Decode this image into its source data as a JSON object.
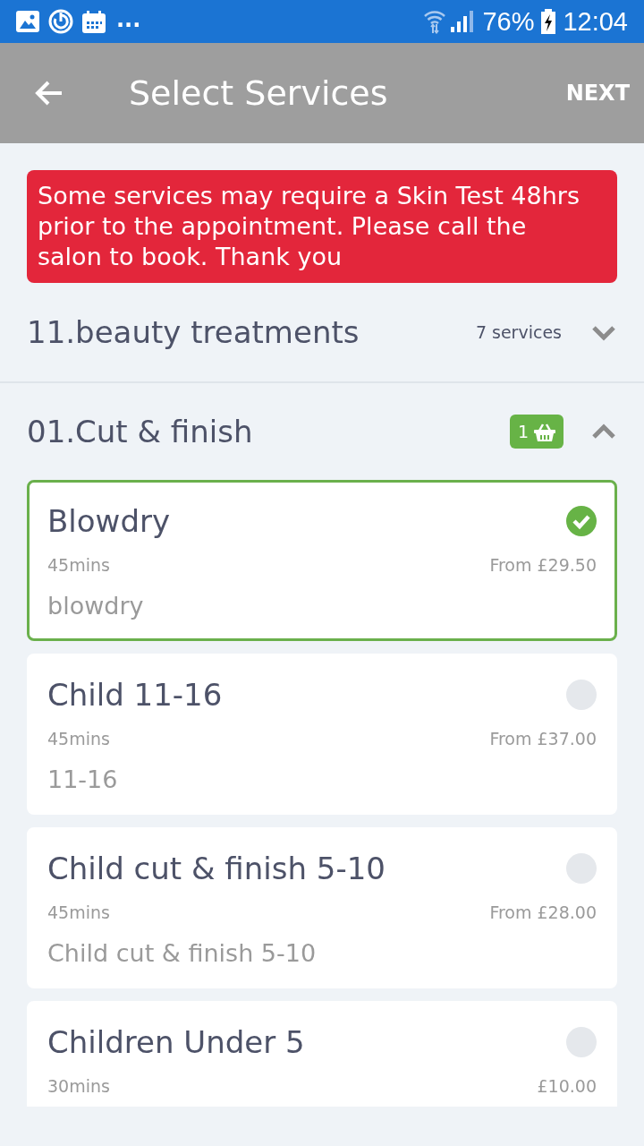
{
  "status_bar": {
    "overflow": "...",
    "battery_level": "76%",
    "time": "12:04"
  },
  "app_bar": {
    "title": "Select Services",
    "action": "NEXT"
  },
  "notice": "Some services may require a Skin Test 48hrs prior to the appointment. Please call the salon to book. Thank you",
  "categories": [
    {
      "name": "11.beauty treatments",
      "count": "7 services",
      "expanded": false
    },
    {
      "name": "01.Cut & finish",
      "basket_count": "1",
      "expanded": true,
      "services": [
        {
          "name": "Blowdry",
          "duration": "45mins",
          "price": "From £29.50",
          "description": "blowdry",
          "selected": true
        },
        {
          "name": "Child 11-16",
          "duration": "45mins",
          "price": "From £37.00",
          "description": "11-16",
          "selected": false
        },
        {
          "name": "Child cut & finish 5-10",
          "duration": "45mins",
          "price": "From £28.00",
          "description": "Child cut & finish 5-10",
          "selected": false
        },
        {
          "name": "Children Under 5",
          "duration": "30mins",
          "price": "£10.00",
          "selected": false
        }
      ]
    }
  ]
}
